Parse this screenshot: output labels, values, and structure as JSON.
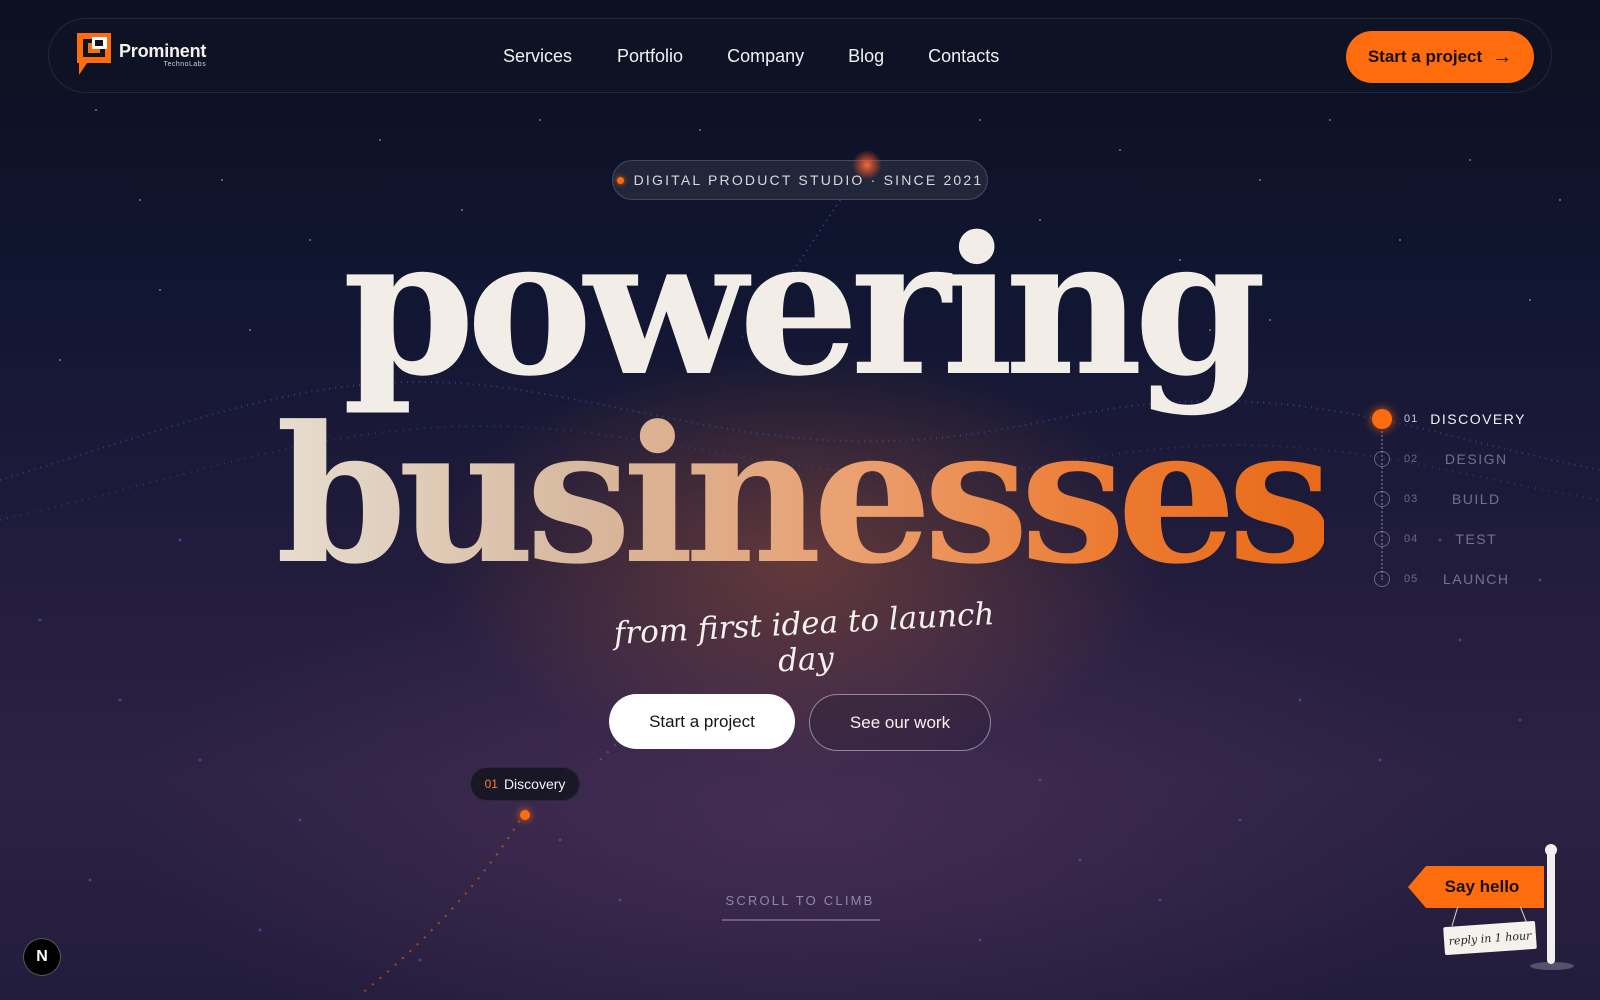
{
  "brand": {
    "name": "Prominent",
    "sub": "TechnoLabs",
    "accent": "#ff6c0e"
  },
  "nav": {
    "items": [
      {
        "label": "Services"
      },
      {
        "label": "Portfolio"
      },
      {
        "label": "Company"
      },
      {
        "label": "Blog"
      },
      {
        "label": "Contacts"
      }
    ],
    "cta": {
      "label": "Start a project",
      "icon": "arrow-right-icon"
    }
  },
  "hero": {
    "badge": "DIGITAL PRODUCT STUDIO · SINCE 2021",
    "headline_line1": "powering",
    "headline_line2": "businesses",
    "tagline": "from first idea to launch day",
    "primary_button": "Start a project",
    "secondary_button": "See our work"
  },
  "marker": {
    "number": "01",
    "label": "Discovery"
  },
  "steps": [
    {
      "number": "01",
      "label": "DISCOVERY",
      "active": true
    },
    {
      "number": "02",
      "label": "DESIGN",
      "active": false
    },
    {
      "number": "03",
      "label": "BUILD",
      "active": false
    },
    {
      "number": "04",
      "label": "TEST",
      "active": false
    },
    {
      "number": "05",
      "label": "LAUNCH",
      "active": false
    }
  ],
  "scroll_hint": "SCROLL TO CLIMB",
  "say_hello": {
    "label": "Say hello",
    "note": "reply in 1 hour"
  },
  "dev_badge": {
    "label": "N"
  }
}
